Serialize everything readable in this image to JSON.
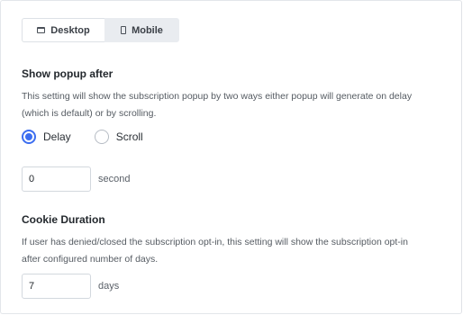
{
  "tabs": {
    "desktop": {
      "label": "Desktop",
      "icon": "desktop-icon",
      "active": true
    },
    "mobile": {
      "label": "Mobile",
      "icon": "mobile-icon",
      "active": false
    }
  },
  "popup_timing": {
    "title": "Show popup after",
    "description_line1": "This setting will show the subscription popup by two ways either popup will generate on delay",
    "description_line2": "(which is default) or by scrolling.",
    "options": [
      {
        "label": "Delay",
        "checked": true
      },
      {
        "label": "Scroll",
        "checked": false
      }
    ],
    "delay_value": "0",
    "delay_unit": "second"
  },
  "cookie": {
    "title": "Cookie Duration",
    "description_line1": "If user has denied/closed the subscription opt-in, this setting will show the subscription opt-in",
    "description_line2": "after configured number of days.",
    "value": "7",
    "unit": "days"
  },
  "colors": {
    "accent": "#3c6ef0",
    "active_tab_bg": "#ffffff",
    "inactive_tab_bg": "#e9ecf0",
    "border": "#d3d8de"
  }
}
